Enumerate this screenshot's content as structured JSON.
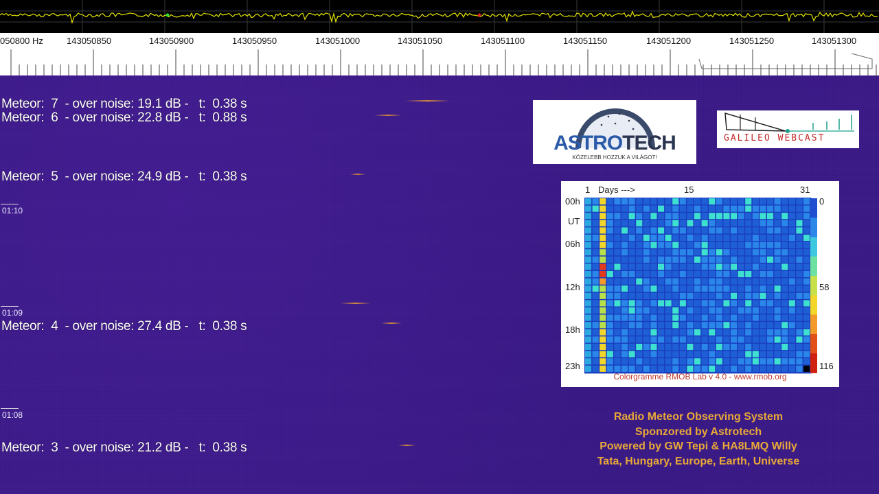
{
  "ruler": {
    "labels": [
      "050800 Hz",
      "143050850",
      "143050900",
      "143050950",
      "143051000",
      "143051050",
      "143051100",
      "143051150",
      "143051200",
      "143051250",
      "143051300"
    ]
  },
  "meteors": [
    {
      "num": "7",
      "text": "Meteor:  7  - over noise: 19.1 dB -   t:  0.38 s"
    },
    {
      "num": "6",
      "text": "Meteor:  6  - over noise: 22.8 dB -   t:  0.88 s"
    },
    {
      "num": "5",
      "text": "Meteor:  5  - over noise: 24.9 dB -   t:  0.38 s"
    },
    {
      "num": "4",
      "text": "Meteor:  4  - over noise: 27.4 dB -   t:  0.38 s"
    },
    {
      "num": "3",
      "text": "Meteor:  3  - over noise: 21.2 dB -   t:  0.38 s"
    }
  ],
  "time_marks": [
    "01:10",
    "01:09",
    "01:08"
  ],
  "logos": {
    "astrotech_word_a": "ASTRO",
    "astrotech_word_b": "TECH",
    "astrotech_tagline": "KÖZELEBB HOZZUK A VILÁGOT!",
    "galileo": "GALILEO WEBCAST"
  },
  "colorgramme": {
    "label_day_start": "1",
    "label_days": "Days --->",
    "label_day_mid": "15",
    "label_day_end": "31",
    "row_labels": [
      "00h",
      "UT",
      "06h",
      "12h",
      "18h",
      "23h"
    ],
    "scale_labels": [
      "0",
      "58",
      "116"
    ],
    "footer": "Colorgramme RMOB Lab v 4.0 - www.rmob.org"
  },
  "footer": {
    "line1": "Radio Meteor Observing System",
    "line2": "Sponzored by Astrotech",
    "line3": "Powered by GW Tepi & HA8LMQ Willy",
    "line4": "Tata, Hungary, Europe, Earth, Universe"
  },
  "colors": {
    "waterfall": "#3b1a88",
    "footer_text": "#e8a838",
    "scope_trace": "#e6e600",
    "astro_blue": "#2a5aa8"
  }
}
